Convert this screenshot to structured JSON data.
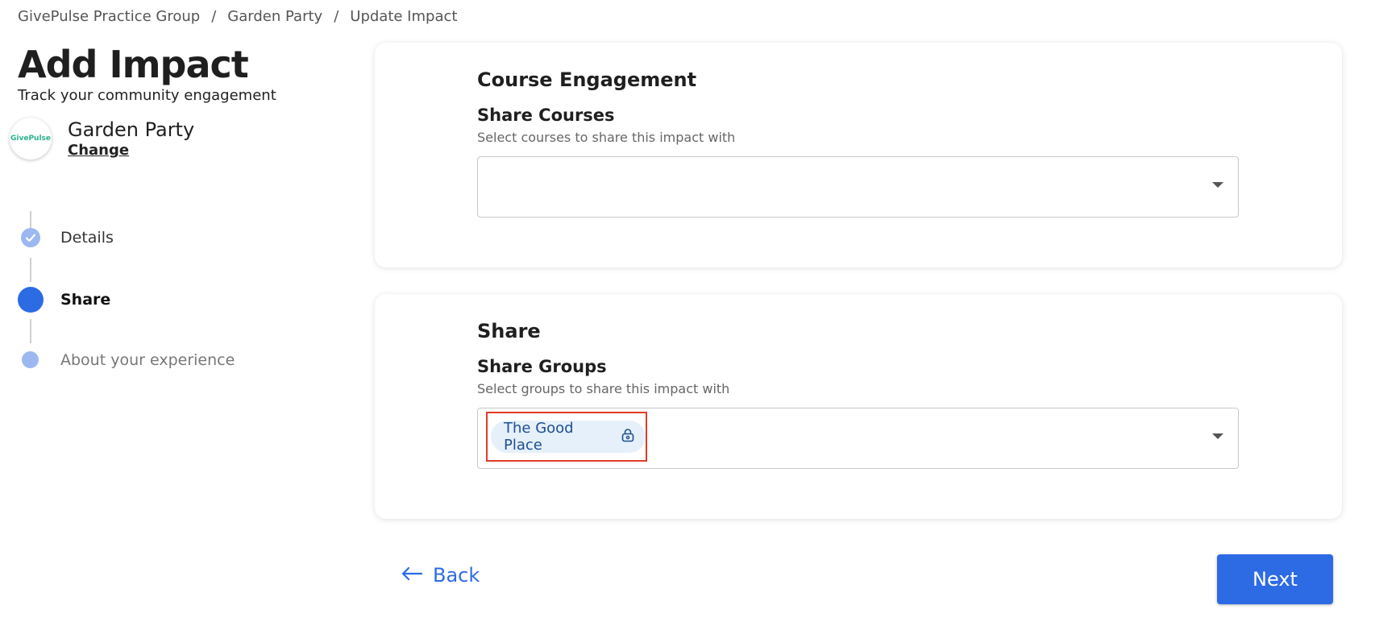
{
  "breadcrumb": {
    "items": [
      "GivePulse Practice Group",
      "Garden Party",
      "Update Impact"
    ],
    "separator": "/"
  },
  "header": {
    "title": "Add Impact",
    "subtitle": "Track your community engagement"
  },
  "project": {
    "logo_text": "GivePulse",
    "name": "Garden Party",
    "change_label": "Change"
  },
  "steps": [
    {
      "label": "Details",
      "state": "completed"
    },
    {
      "label": "Share",
      "state": "current"
    },
    {
      "label": "About your experience",
      "state": "upcoming"
    }
  ],
  "course_card": {
    "title": "Course Engagement",
    "field_label": "Share Courses",
    "field_help": "Select courses to share this impact with",
    "selected": []
  },
  "share_card": {
    "title": "Share",
    "field_label": "Share Groups",
    "field_help": "Select groups to share this impact with",
    "selected": [
      {
        "label": "The Good Place",
        "icon": "lock-icon"
      }
    ]
  },
  "actions": {
    "back_label": "Back",
    "next_label": "Next"
  },
  "colors": {
    "accent": "#2d6be4",
    "step_done": "#9db8f0",
    "chip_bg": "#e6f0fa",
    "highlight": "#e23b25"
  }
}
